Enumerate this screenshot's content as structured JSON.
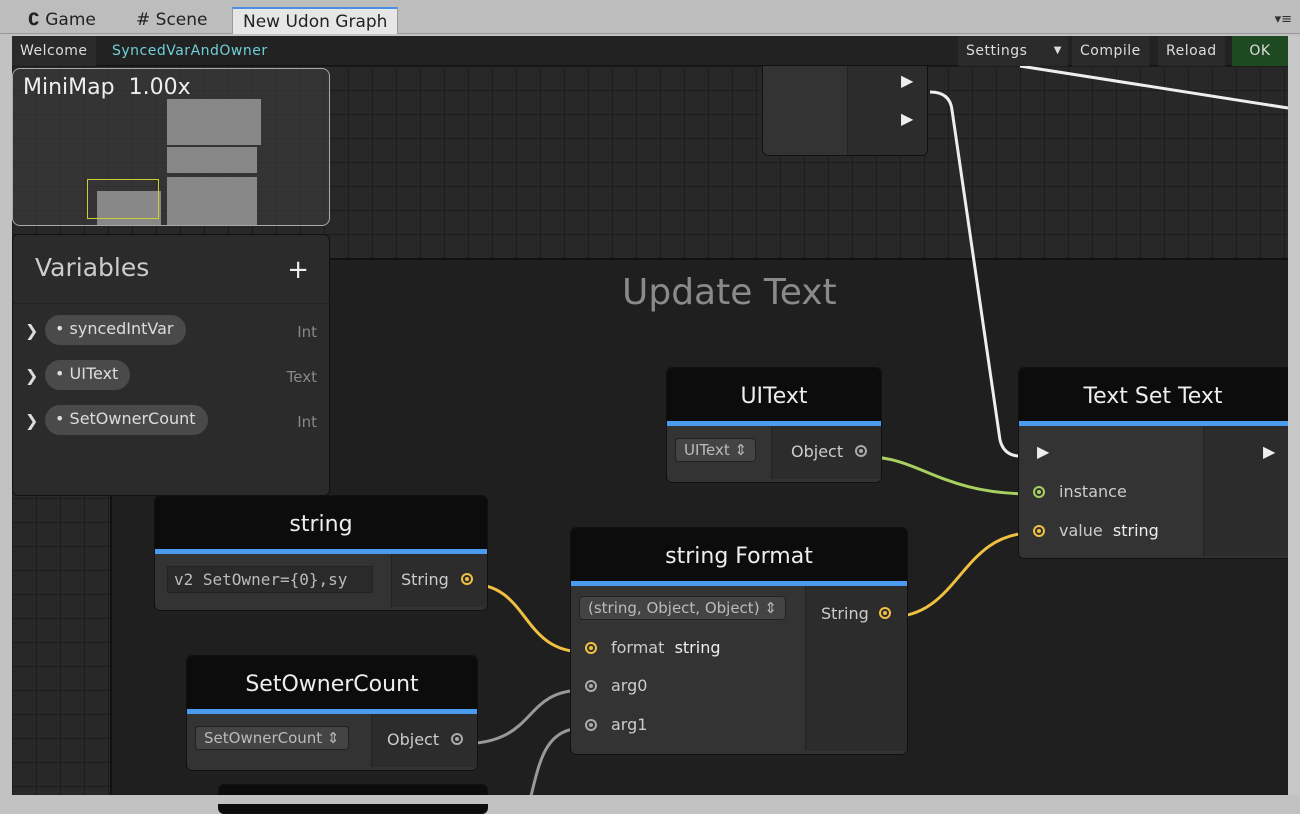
{
  "tabs": [
    {
      "label": "Game",
      "icon": "game-controller-icon"
    },
    {
      "label": "Scene",
      "icon": "grid-icon"
    },
    {
      "label": "New Udon Graph"
    }
  ],
  "toolbar": {
    "welcome": "Welcome",
    "graph_name": "SyncedVarAndOwner",
    "settings": "Settings",
    "compile": "Compile",
    "reload": "Reload",
    "ok": "OK"
  },
  "minimap": {
    "label": "MiniMap",
    "zoom": "1.00x"
  },
  "variables": {
    "title": "Variables",
    "add": "+",
    "items": [
      {
        "name": "syncedIntVar",
        "type": "Int"
      },
      {
        "name": "UIText",
        "type": "Text"
      },
      {
        "name": "SetOwnerCount",
        "type": "Int"
      }
    ]
  },
  "group": {
    "title": "Update Text"
  },
  "nodes": {
    "uitext": {
      "title": "UIText",
      "select": "UIText",
      "out": "Object"
    },
    "textset": {
      "title": "Text Set Text",
      "instance": "instance",
      "value": "value",
      "value_type": "string"
    },
    "string": {
      "title": "string",
      "value": "v2 SetOwner={0},sy",
      "out": "String"
    },
    "format": {
      "title": "string Format",
      "select": "(string, Object, Object)",
      "format": "format",
      "format_type": "string",
      "arg0": "arg0",
      "arg1": "arg1",
      "out": "String"
    },
    "owner": {
      "title": "SetOwnerCount",
      "select": "SetOwnerCount",
      "out": "Object"
    }
  },
  "colors": {
    "accent": "#4a9bf0",
    "ok": "#1e4a22",
    "string_port": "#f0c040",
    "object_port": "#a8d060",
    "graph_name": "#6fd0d8"
  }
}
